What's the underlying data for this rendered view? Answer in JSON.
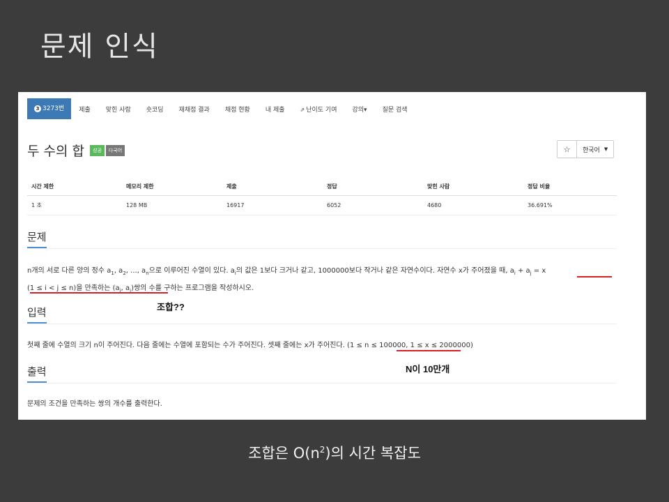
{
  "slide": {
    "title": "문제 인식",
    "caption_prefix": "조합은 O(n",
    "caption_sup": "2",
    "caption_suffix": ")의 시간 복잡도"
  },
  "nav": {
    "active_badge": "3",
    "active_label": "3273번",
    "items": [
      "제출",
      "맞힌 사람",
      "숏코딩",
      "재채점 결과",
      "채점 현황",
      "내 제출",
      "난이도 기여",
      "강의▾",
      "질문 검색"
    ]
  },
  "problem": {
    "title": "두 수의 합",
    "badges": [
      "성공",
      "다국어"
    ],
    "star_icon": "star-icon",
    "language": "한국어",
    "table_headers": [
      "시간 제한",
      "메모리 제한",
      "제출",
      "정답",
      "맞힌 사람",
      "정답 비율"
    ],
    "table_values": [
      "1 초",
      "128 MB",
      "16917",
      "6052",
      "4680",
      "36.691%"
    ]
  },
  "sections": {
    "problem_head": "문제",
    "input_head": "입력",
    "output_head": "출력"
  },
  "text": {
    "p1_a": "n개의 서로 다른 양의 정수 a",
    "p1_sub1": "1",
    "p1_b": ", a",
    "p1_sub2": "2",
    "p1_c": ", ..., a",
    "p1_subn": "n",
    "p1_d": "으로 이루어진 수열이 있다. a",
    "p1_subi": "i",
    "p1_e": "의 값은 1보다 크거나 같고, 1000000보다 작거나 같은 자연수이다. 자연수 x가 주어졌을 때, a",
    "p1_subi2": "i",
    "p1_f": " + a",
    "p1_subj": "j",
    "p1_g": " = x",
    "p2_a": "(1 ≤ i < j ≤ n)을 만족하는 (a",
    "p2_subi": "i",
    "p2_b": ", a",
    "p2_subj": "j",
    "p2_c": ")쌍의 수를 구하는 프로그램을 작성하시오.",
    "input_text": "첫째 줄에 수열의 크기 n이 주어진다. 다음 줄에는 수열에 포함되는 수가 주어진다. 셋째 줄에는 x가 주어진다. (1 ≤ n ≤ 100000, 1 ≤ x ≤ 2000000)",
    "output_text": "문제의 조건을 만족하는 쌍의 개수를 출력한다."
  },
  "annotations": {
    "combination": "조합??",
    "n_count": "N이 10만개"
  },
  "colors": {
    "background": "#3c3c3c",
    "nav_active": "#3c79b5",
    "success_badge": "#5cb85c",
    "annotation_underline": "#d42020"
  }
}
